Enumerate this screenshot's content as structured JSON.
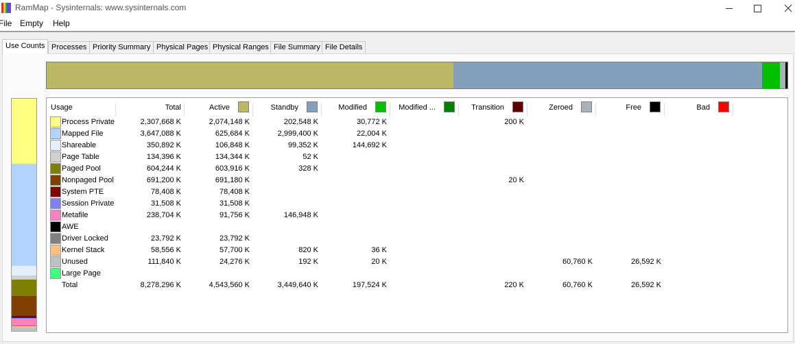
{
  "window": {
    "title": "RamMap - Sysinternals: www.sysinternals.com"
  },
  "menu": {
    "items": [
      "File",
      "Empty",
      "Help"
    ]
  },
  "tabs": [
    {
      "label": "Use Counts",
      "active": true
    },
    {
      "label": "Processes",
      "active": false
    },
    {
      "label": "Priority Summary",
      "active": false
    },
    {
      "label": "Physical Pages",
      "active": false
    },
    {
      "label": "Physical Ranges",
      "active": false
    },
    {
      "label": "File Summary",
      "active": false
    },
    {
      "label": "File Details",
      "active": false
    }
  ],
  "columns": [
    {
      "label": "Usage",
      "color": null
    },
    {
      "label": "Total",
      "color": null
    },
    {
      "label": "Active",
      "color": "#bdb865"
    },
    {
      "label": "Standby",
      "color": "#85a0bd"
    },
    {
      "label": "Modified",
      "color": "#00c000"
    },
    {
      "label": "Modified ...",
      "color": "#008000"
    },
    {
      "label": "Transition",
      "color": "#600000"
    },
    {
      "label": "Zeroed",
      "color": "#a9b2bb"
    },
    {
      "label": "Free",
      "color": "#000000"
    },
    {
      "label": "Bad",
      "color": "#ff0000"
    }
  ],
  "rows": [
    {
      "label": "Process Private",
      "color": "#ffff80",
      "values": [
        "2,307,668 K",
        "2,074,148 K",
        "202,548 K",
        "30,772 K",
        "",
        "200 K",
        "",
        "",
        ""
      ]
    },
    {
      "label": "Mapped File",
      "color": "#b0d4ff",
      "values": [
        "3,647,088 K",
        "625,684 K",
        "2,999,400 K",
        "22,004 K",
        "",
        "",
        "",
        "",
        ""
      ]
    },
    {
      "label": "Shareable",
      "color": "#e3effa",
      "values": [
        "350,892 K",
        "106,848 K",
        "99,352 K",
        "144,692 K",
        "",
        "",
        "",
        "",
        ""
      ]
    },
    {
      "label": "Page Table",
      "color": "#d0d0d0",
      "values": [
        "134,396 K",
        "134,344 K",
        "52 K",
        "",
        "",
        "",
        "",
        "",
        ""
      ]
    },
    {
      "label": "Paged Pool",
      "color": "#808000",
      "values": [
        "604,244 K",
        "603,916 K",
        "328 K",
        "",
        "",
        "",
        "",
        "",
        ""
      ]
    },
    {
      "label": "Nonpaged Pool",
      "color": "#804000",
      "values": [
        "691,200 K",
        "691,180 K",
        "",
        "",
        "",
        "20 K",
        "",
        "",
        ""
      ]
    },
    {
      "label": "System PTE",
      "color": "#800000",
      "values": [
        "78,408 K",
        "78,408 K",
        "",
        "",
        "",
        "",
        "",
        "",
        ""
      ]
    },
    {
      "label": "Session Private",
      "color": "#8080ff",
      "values": [
        "31,508 K",
        "31,508 K",
        "",
        "",
        "",
        "",
        "",
        "",
        ""
      ]
    },
    {
      "label": "Metafile",
      "color": "#ff80c0",
      "values": [
        "238,704 K",
        "91,756 K",
        "146,948 K",
        "",
        "",
        "",
        "",
        "",
        ""
      ]
    },
    {
      "label": "AWE",
      "color": "#000000",
      "values": [
        "",
        "",
        "",
        "",
        "",
        "",
        "",
        "",
        ""
      ]
    },
    {
      "label": "Driver Locked",
      "color": "#808080",
      "values": [
        "23,792 K",
        "23,792 K",
        "",
        "",
        "",
        "",
        "",
        "",
        ""
      ]
    },
    {
      "label": "Kernel Stack",
      "color": "#ffc080",
      "values": [
        "58,556 K",
        "57,700 K",
        "820 K",
        "36 K",
        "",
        "",
        "",
        "",
        ""
      ]
    },
    {
      "label": "Unused",
      "color": "#c0c0c0",
      "values": [
        "111,840 K",
        "24,276 K",
        "192 K",
        "20 K",
        "",
        "",
        "60,760 K",
        "26,592 K",
        ""
      ]
    },
    {
      "label": "Large Page",
      "color": "#40ff80",
      "values": [
        "",
        "",
        "",
        "",
        "",
        "",
        "",
        "",
        ""
      ]
    },
    {
      "label": "Total",
      "color": null,
      "values": [
        "8,278,296 K",
        "4,543,560 K",
        "3,449,640 K",
        "197,524 K",
        "",
        "220 K",
        "60,760 K",
        "26,592 K",
        ""
      ]
    }
  ],
  "list_summary": {
    "segments": [
      {
        "name": "active",
        "fraction": 0.5489,
        "color": "#bdb865"
      },
      {
        "name": "standby",
        "fraction": 0.4167,
        "color": "#85a0bd"
      },
      {
        "name": "modified",
        "fraction": 0.0239,
        "color": "#00c000"
      },
      {
        "name": "modified-no-write",
        "fraction": 0.0,
        "color": "#008000"
      },
      {
        "name": "transition",
        "fraction": 0.0,
        "color": "#600000"
      },
      {
        "name": "zeroed",
        "fraction": 0.0073,
        "color": "#a9b2bb"
      },
      {
        "name": "free",
        "fraction": 0.0032,
        "color": "#000000"
      }
    ]
  },
  "usage_summary": {
    "segments": [
      {
        "name": "process-private",
        "fraction": 0.2788,
        "color": "#ffff80"
      },
      {
        "name": "mapped-file",
        "fraction": 0.4406,
        "color": "#b0d4ff"
      },
      {
        "name": "shareable",
        "fraction": 0.0424,
        "color": "#e3effa"
      },
      {
        "name": "page-table",
        "fraction": 0.0162,
        "color": "#d0d0d0"
      },
      {
        "name": "paged-pool",
        "fraction": 0.073,
        "color": "#808000"
      },
      {
        "name": "nonpaged-pool",
        "fraction": 0.0835,
        "color": "#804000"
      },
      {
        "name": "system-pte",
        "fraction": 0.0095,
        "color": "#800000"
      },
      {
        "name": "session-private",
        "fraction": 0.0038,
        "color": "#8080ff"
      },
      {
        "name": "metafile",
        "fraction": 0.0288,
        "color": "#ff80c0"
      },
      {
        "name": "driver-locked",
        "fraction": 0.0029,
        "color": "#808080"
      },
      {
        "name": "kernel-stack",
        "fraction": 0.0071,
        "color": "#ffc080"
      },
      {
        "name": "unused",
        "fraction": 0.0135,
        "color": "#c0c0c0"
      }
    ]
  }
}
